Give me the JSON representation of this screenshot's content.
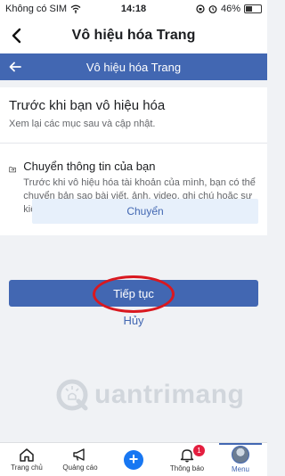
{
  "status": {
    "carrier": "Không có SIM",
    "time": "14:18",
    "battery": "46%",
    "battery_level": 0.46
  },
  "nav": {
    "title": "Vô hiệu hóa Trang"
  },
  "header": {
    "title": "Vô hiệu hóa Trang"
  },
  "before": {
    "title": "Trước khi bạn vô hiệu hóa",
    "subtitle": "Xem lại các mục sau và cập nhật."
  },
  "transfer": {
    "title": "Chuyển thông tin của bạn",
    "description": "Trước khi vô hiệu hóa tài khoản của mình, bạn có thể chuyển bản sao bài viết, ảnh, video, ghi chú hoặc sự kiện sang thiết bị khác.",
    "button": "Chuyển"
  },
  "actions": {
    "continue": "Tiếp tục",
    "cancel": "Hủy"
  },
  "watermark": {
    "text": "uantrimang"
  },
  "tabs": [
    {
      "label": "Trang chủ",
      "icon": "home-icon"
    },
    {
      "label": "Quảng cáo",
      "icon": "megaphone-icon"
    },
    {
      "label": "",
      "icon": "plus-icon"
    },
    {
      "label": "Thông báo",
      "icon": "bell-icon",
      "badge": "1"
    },
    {
      "label": "Menu",
      "icon": "avatar-icon",
      "active": true
    }
  ],
  "colors": {
    "brand": "#4267b2",
    "primary_blue": "#1877f2",
    "highlight": "#d9181f",
    "badge": "#e41e3f"
  }
}
